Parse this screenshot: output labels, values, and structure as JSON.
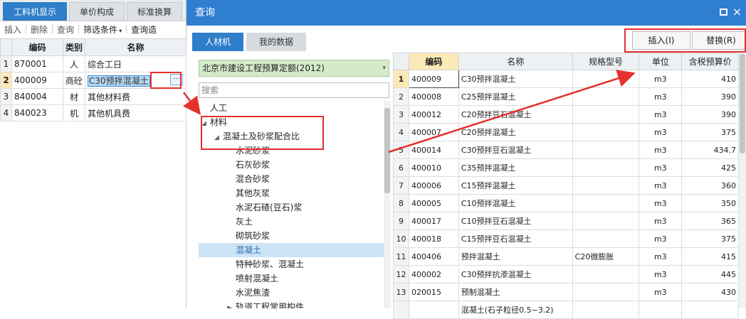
{
  "left_panel": {
    "tabs": [
      "工料机显示",
      "单价构成",
      "标准换算"
    ],
    "toolbar": {
      "insert": "插入",
      "delete": "删除",
      "query": "查询",
      "filter": "筛选条件",
      "query_more": "查询造"
    },
    "columns": [
      "编码",
      "类别",
      "名称"
    ],
    "rows": [
      {
        "num": "1",
        "code": "870001",
        "type": "人",
        "name": "综合工日"
      },
      {
        "num": "2",
        "code": "400009",
        "type": "商砼",
        "name": "C30预拌混凝土"
      },
      {
        "num": "3",
        "code": "840004",
        "type": "材",
        "name": "其他材料费"
      },
      {
        "num": "4",
        "code": "840023",
        "type": "机",
        "name": "其他机具费"
      }
    ],
    "ellipsis": "···"
  },
  "dialog": {
    "title": "查询",
    "close": "×",
    "tabs": [
      "人材机",
      "我的数据"
    ],
    "insert_button": "插入(I)",
    "replace_button": "替换(R)",
    "library": "北京市建设工程预算定额(2012)",
    "search_placeholder": "搜索",
    "tree": [
      {
        "label": "人工",
        "indent": 0,
        "toggle": ""
      },
      {
        "label": "材料",
        "indent": 0,
        "toggle": "◢"
      },
      {
        "label": "混凝土及砂浆配合比",
        "indent": 1,
        "toggle": "◢"
      },
      {
        "label": "水泥砂浆",
        "indent": 2,
        "toggle": ""
      },
      {
        "label": "石灰砂浆",
        "indent": 2,
        "toggle": ""
      },
      {
        "label": "混合砂浆",
        "indent": 2,
        "toggle": ""
      },
      {
        "label": "其他灰浆",
        "indent": 2,
        "toggle": ""
      },
      {
        "label": "水泥石碴(豆石)浆",
        "indent": 2,
        "toggle": ""
      },
      {
        "label": "灰土",
        "indent": 2,
        "toggle": ""
      },
      {
        "label": "砌筑砂浆",
        "indent": 2,
        "toggle": ""
      },
      {
        "label": "混凝土",
        "indent": 2,
        "toggle": "",
        "selected": true
      },
      {
        "label": "特种砂浆、混凝土",
        "indent": 2,
        "toggle": ""
      },
      {
        "label": "喷射混凝土",
        "indent": 2,
        "toggle": ""
      },
      {
        "label": "水泥焦渣",
        "indent": 2,
        "toggle": ""
      },
      {
        "label": "轨道工程常用构件",
        "indent": 1,
        "toggle": "▶"
      }
    ],
    "columns": [
      "编码",
      "名称",
      "规格型号",
      "单位",
      "含税预算价"
    ],
    "rows": [
      {
        "num": "1",
        "code": "400009",
        "name": "C30预拌混凝土",
        "spec": "",
        "unit": "m3",
        "price": "410"
      },
      {
        "num": "2",
        "code": "400008",
        "name": "C25预拌混凝土",
        "spec": "",
        "unit": "m3",
        "price": "390"
      },
      {
        "num": "3",
        "code": "400012",
        "name": "C20预拌豆石混凝土",
        "spec": "",
        "unit": "m3",
        "price": "390"
      },
      {
        "num": "4",
        "code": "400007",
        "name": "C20预拌混凝土",
        "spec": "",
        "unit": "m3",
        "price": "375"
      },
      {
        "num": "5",
        "code": "400014",
        "name": "C30预拌豆石混凝土",
        "spec": "",
        "unit": "m3",
        "price": "434.7"
      },
      {
        "num": "6",
        "code": "400010",
        "name": "C35预拌混凝土",
        "spec": "",
        "unit": "m3",
        "price": "425"
      },
      {
        "num": "7",
        "code": "400006",
        "name": "C15预拌混凝土",
        "spec": "",
        "unit": "m3",
        "price": "360"
      },
      {
        "num": "8",
        "code": "400005",
        "name": "C10预拌混凝土",
        "spec": "",
        "unit": "m3",
        "price": "350"
      },
      {
        "num": "9",
        "code": "400017",
        "name": "C10预拌豆石混凝土",
        "spec": "",
        "unit": "m3",
        "price": "365"
      },
      {
        "num": "10",
        "code": "400018",
        "name": "C15预拌豆石混凝土",
        "spec": "",
        "unit": "m3",
        "price": "375"
      },
      {
        "num": "11",
        "code": "400406",
        "name": "预拌混凝土",
        "spec": "C20微膨胀",
        "unit": "m3",
        "price": "415"
      },
      {
        "num": "12",
        "code": "400002",
        "name": "C30预拌抗渗混凝土",
        "spec": "",
        "unit": "m3",
        "price": "445"
      },
      {
        "num": "13",
        "code": "020015",
        "name": "预制混凝土",
        "spec": "",
        "unit": "m3",
        "price": "430"
      },
      {
        "num": "",
        "code": "",
        "name": "混凝土(石子粒径0.5~3.2)",
        "spec": "",
        "unit": "",
        "price": ""
      }
    ]
  },
  "colors": {
    "accent": "#2e7ec9",
    "annotation": "#e5302d",
    "selected_row": "#fbe9b7",
    "library_bg": "#d4ebc9"
  }
}
